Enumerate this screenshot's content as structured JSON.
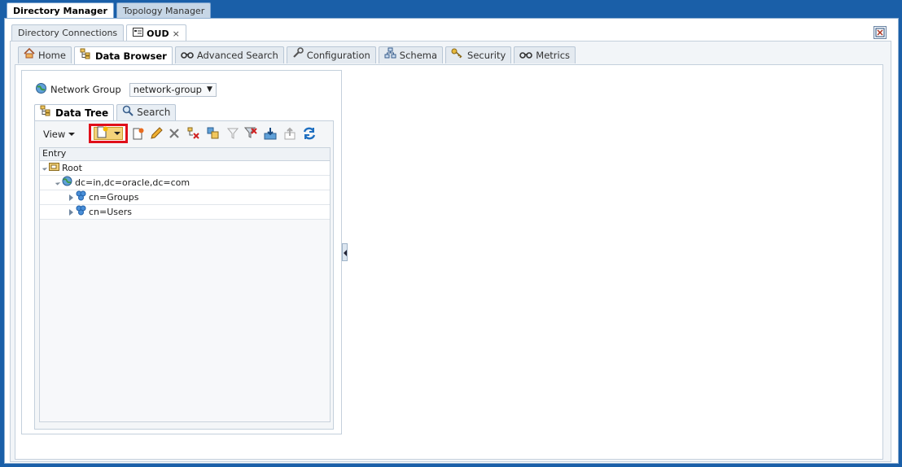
{
  "app_tabs": [
    {
      "label": "Directory Manager",
      "active": true
    },
    {
      "label": "Topology Manager",
      "active": false
    }
  ],
  "connection_tabs": [
    {
      "label": "Directory Connections",
      "active": false
    },
    {
      "label": "OUD",
      "active": true,
      "close": "×"
    }
  ],
  "main_tabs": [
    {
      "label": "Home",
      "icon": "home-icon"
    },
    {
      "label": "Data Browser",
      "icon": "tree-icon",
      "active": true
    },
    {
      "label": "Advanced Search",
      "icon": "binoculars-icon"
    },
    {
      "label": "Configuration",
      "icon": "wrench-icon"
    },
    {
      "label": "Schema",
      "icon": "schema-icon"
    },
    {
      "label": "Security",
      "icon": "key-icon"
    },
    {
      "label": "Metrics",
      "icon": "binoculars-icon"
    }
  ],
  "network_group": {
    "label": "Network Group",
    "value": "network-group",
    "caret": "▼"
  },
  "sub_tabs": [
    {
      "label": "Data Tree",
      "active": true
    },
    {
      "label": "Search",
      "active": false
    }
  ],
  "toolbar": {
    "view_label": "View",
    "highlight_color": "#e0101a"
  },
  "grid": {
    "header": "Entry",
    "rows": [
      {
        "label": "Root",
        "level": 0,
        "expanded": true,
        "icon": "folder-icon"
      },
      {
        "label": "dc=in,dc=oracle,dc=com",
        "level": 1,
        "expanded": true,
        "icon": "globe-icon"
      },
      {
        "label": "cn=Groups",
        "level": 2,
        "expanded": false,
        "icon": "gear-icon"
      },
      {
        "label": "cn=Users",
        "level": 2,
        "expanded": false,
        "icon": "gear-icon"
      }
    ]
  }
}
